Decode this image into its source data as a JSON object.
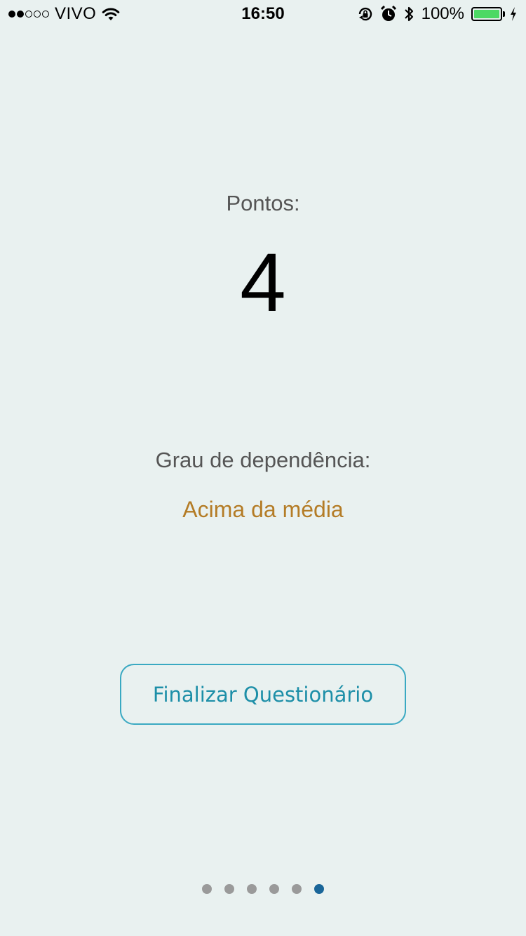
{
  "status_bar": {
    "signal_filled": 2,
    "signal_total": 5,
    "carrier": "VIVO",
    "time": "16:50",
    "battery_percent": "100%",
    "battery_level": 1.0,
    "battery_color": "#4cd964",
    "icons": [
      "wifi-icon",
      "rotation-lock-icon",
      "alarm-icon",
      "bluetooth-icon",
      "battery-icon",
      "charging-bolt-icon"
    ]
  },
  "result": {
    "points_label": "Pontos:",
    "points_value": "4",
    "grau_label": "Grau de dependência:",
    "grau_value": "Acima da média",
    "grau_color": "#b47c26"
  },
  "actions": {
    "finish_label": "Finalizar Questionário",
    "accent_color": "#3aa9c2"
  },
  "pagination": {
    "total_pages": 6,
    "current_page": 6,
    "active_color": "#1a6699",
    "inactive_color": "#9a9a9a"
  }
}
